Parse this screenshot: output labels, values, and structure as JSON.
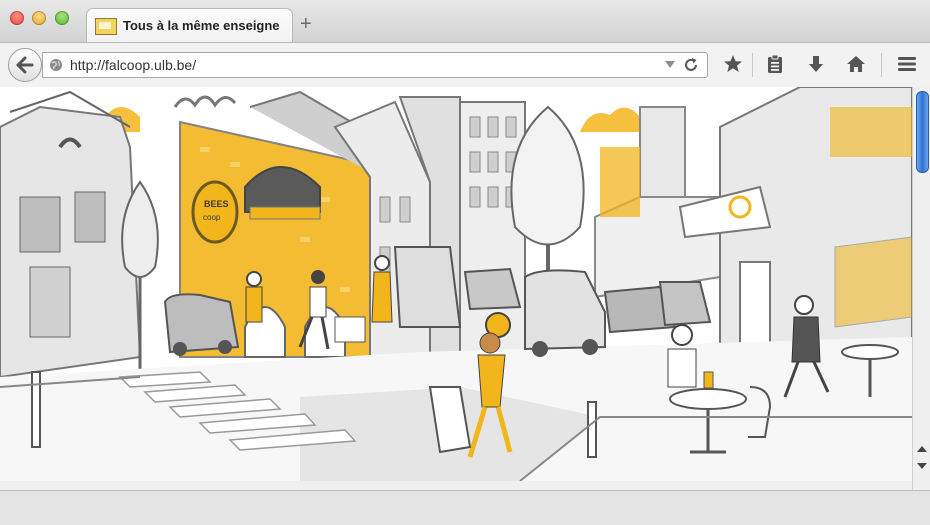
{
  "window": {
    "tab_title": "Tous à la même enseigne",
    "new_tab_symbol": "+"
  },
  "navbar": {
    "url": "http://falcoop.ulb.be/"
  },
  "icons": {
    "back": "back-arrow-icon",
    "globe": "globe-icon",
    "reload": "reload-icon",
    "bookmark": "star-icon",
    "reading_list": "clipboard-icon",
    "downloads": "download-icon",
    "home": "home-icon",
    "menu": "hamburger-menu-icon"
  },
  "illustration": {
    "shop_sign": "BEES coop"
  },
  "colors": {
    "accent_yellow": "#f2b51c",
    "scroll_thumb": "#2f72d4"
  }
}
